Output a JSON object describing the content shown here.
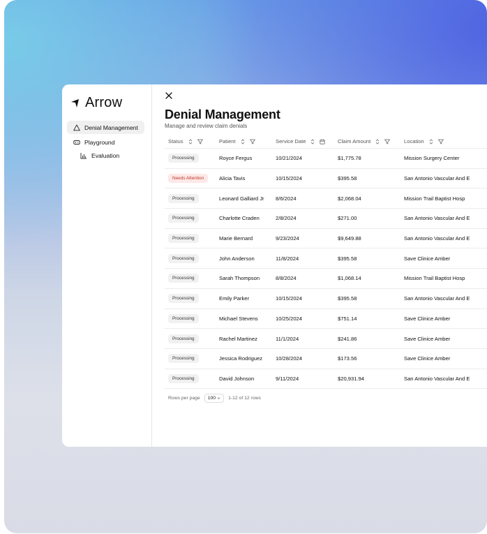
{
  "app": {
    "name": "Arrow"
  },
  "sidebar": {
    "items": [
      {
        "label": "Denial Management",
        "icon": "warning-triangle-icon",
        "active": true
      },
      {
        "label": "Playground",
        "icon": "gamepad-icon"
      },
      {
        "label": "Evaluation",
        "icon": "bar-chart-icon",
        "sub": true
      }
    ]
  },
  "page": {
    "title": "Denial Management",
    "subtitle": "Manage and review claim denials"
  },
  "table": {
    "columns": [
      {
        "label": "Status",
        "icons": [
          "sort-icon",
          "filter-icon"
        ]
      },
      {
        "label": "Patient",
        "icons": [
          "sort-icon",
          "filter-icon"
        ]
      },
      {
        "label": "Service Date",
        "icons": [
          "sort-icon",
          "calendar-icon"
        ]
      },
      {
        "label": "Claim Amount",
        "icons": [
          "sort-icon",
          "filter-icon"
        ]
      },
      {
        "label": "Location",
        "icons": [
          "sort-icon",
          "filter-icon"
        ]
      }
    ],
    "rows": [
      {
        "status": "Processing",
        "patient": "Royce Fergus",
        "date": "10/21/2024",
        "amount": "$1,775.78",
        "location": "Mission Surgery Center"
      },
      {
        "status": "Needs Attention",
        "patient": "Alicia Tavis",
        "date": "10/15/2024",
        "amount": "$395.58",
        "location": "San Antonio Vascular And E"
      },
      {
        "status": "Processing",
        "patient": "Leonard Galliard Jr",
        "date": "8/6/2024",
        "amount": "$2,068.04",
        "location": "Mission Trail Baptist Hosp"
      },
      {
        "status": "Processing",
        "patient": "Charlotte Craden",
        "date": "2/8/2024",
        "amount": "$271.00",
        "location": "San Antonio Vascular And E"
      },
      {
        "status": "Processing",
        "patient": "Marie Bernard",
        "date": "9/23/2024",
        "amount": "$9,649.88",
        "location": "San Antonio Vascular And E"
      },
      {
        "status": "Processing",
        "patient": "John Anderson",
        "date": "11/8/2024",
        "amount": "$395.58",
        "location": "Save Clinice Amber"
      },
      {
        "status": "Processing",
        "patient": "Sarah Thompson",
        "date": "8/8/2024",
        "amount": "$1,068.14",
        "location": "Mission Trail Baptist Hosp"
      },
      {
        "status": "Processing",
        "patient": "Emily Parker",
        "date": "10/15/2024",
        "amount": "$395.58",
        "location": "San Antonio Vascular And E"
      },
      {
        "status": "Processing",
        "patient": "Michael Stevens",
        "date": "10/25/2024",
        "amount": "$751.14",
        "location": "Save Clinice Amber"
      },
      {
        "status": "Processing",
        "patient": "Rachel Martinez",
        "date": "11/1/2024",
        "amount": "$241.86",
        "location": "Save Clinice Amber"
      },
      {
        "status": "Processing",
        "patient": "Jessica Rodriguez",
        "date": "10/28/2024",
        "amount": "$173.56",
        "location": "Save Clinice Amber"
      },
      {
        "status": "Processing",
        "patient": "David Johnson",
        "date": "9/11/2024",
        "amount": "$20,931.94",
        "location": "San Antonio Vascular And E"
      }
    ]
  },
  "pagination": {
    "rows_per_page_label": "Rows per page",
    "rows_per_page_value": "100",
    "range_text": "1-12 of 12 rows"
  },
  "colors": {
    "attention_bg": "#fde8e8",
    "attention_text": "#c0392b",
    "processing_bg": "#f1f1f1"
  }
}
